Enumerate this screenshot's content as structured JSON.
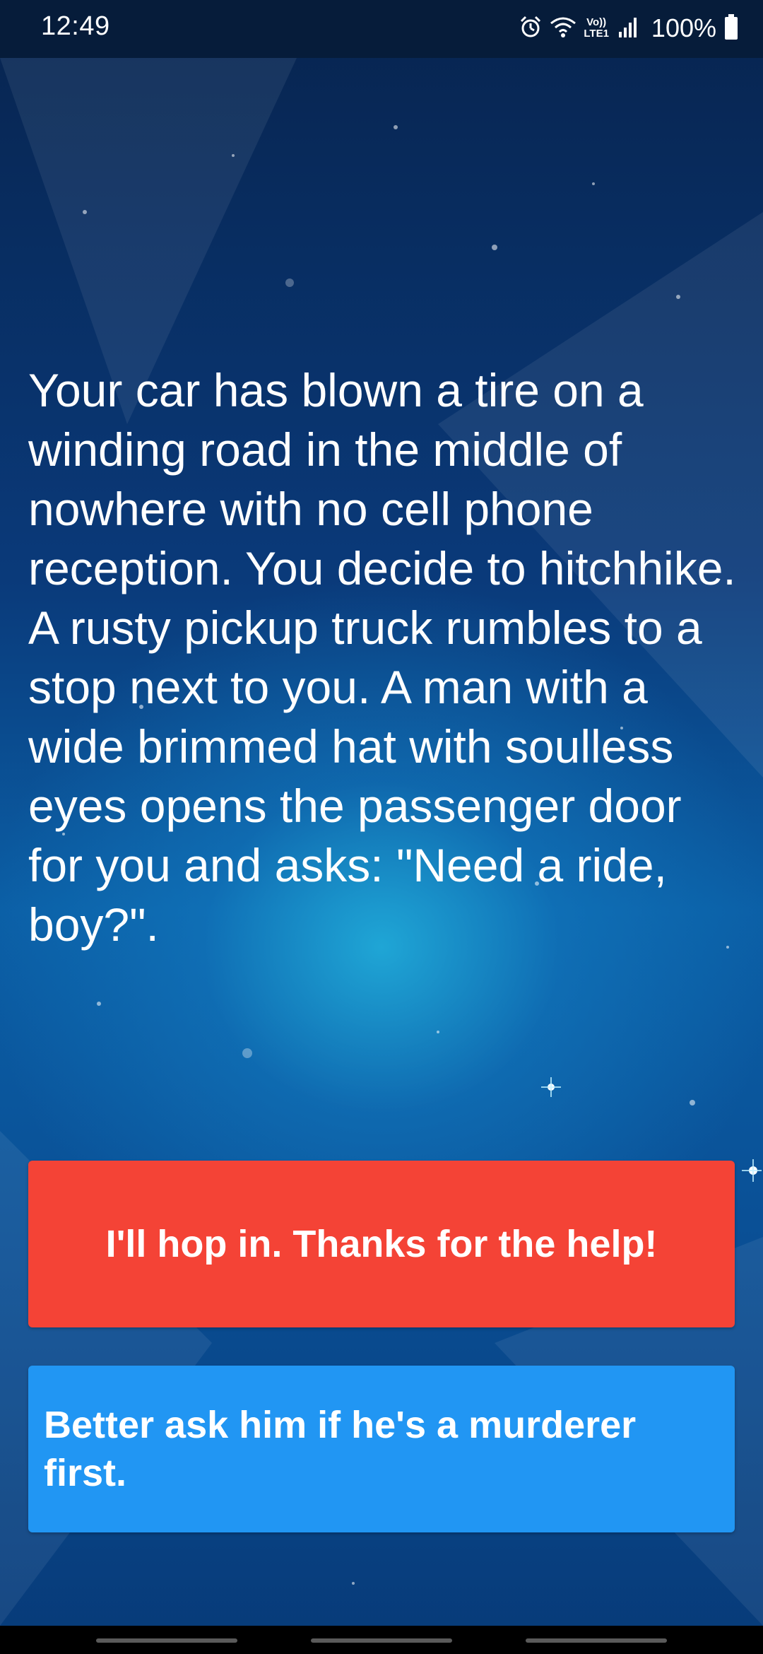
{
  "status_bar": {
    "time": "12:49",
    "network_top": "Vo))",
    "network_bottom": "LTE1",
    "battery": "100%",
    "icons": [
      "alarm-icon",
      "wifi-icon",
      "signal-icon",
      "battery-icon"
    ]
  },
  "story": {
    "text": "Your car has blown a tire on a winding road in the middle of nowhere with no cell phone reception. You decide to hitchhike. A rusty pickup truck rumbles to a stop next to you. A man with a wide brimmed hat with soulless eyes opens the passenger door for you and asks: \"Need a ride, boy?\"."
  },
  "choices": [
    {
      "label": "I'll hop in. Thanks for the help!",
      "color": "#f44336"
    },
    {
      "label": "Better ask him if he's a murderer first.",
      "color": "#2196f3"
    }
  ],
  "nav_bar": {
    "pills": [
      "recents",
      "home",
      "back"
    ]
  }
}
